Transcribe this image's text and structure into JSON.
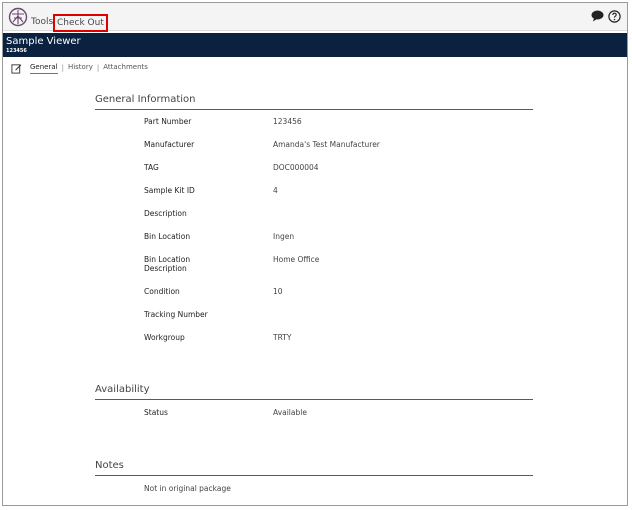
{
  "toolbar": {
    "logo_icon": "brand-logo-icon",
    "tools_label": "Tools",
    "checkout_label": "Check Out",
    "highlight_color": "#e00000",
    "chat_icon": "chat-icon",
    "help_icon": "help-icon"
  },
  "header": {
    "title": "Sample Viewer",
    "subtitle": "123456",
    "background_color": "#0a2240"
  },
  "tabs": [
    {
      "label": "General",
      "active": true
    },
    {
      "label": "History",
      "active": false
    },
    {
      "label": "Attachments",
      "active": false
    }
  ],
  "tab_separator": "|",
  "general": {
    "title": "General Information",
    "fields": [
      {
        "label": "Part Number",
        "value": "123456"
      },
      {
        "label": "Manufacturer",
        "value": "Amanda's Test Manufacturer"
      },
      {
        "label": "TAG",
        "value": "DOC000004"
      },
      {
        "label": "Sample Kit ID",
        "value": "4"
      },
      {
        "label": "Description",
        "value": ""
      },
      {
        "label": "Bin Location",
        "value": "Ingen"
      },
      {
        "label": "Bin Location Description",
        "value": "Home Office"
      },
      {
        "label": "Condition",
        "value": "10"
      },
      {
        "label": "Tracking Number",
        "value": ""
      },
      {
        "label": "Workgroup",
        "value": "TRTY"
      }
    ]
  },
  "availability": {
    "title": "Availability",
    "fields": [
      {
        "label": "Status",
        "value": "Available"
      }
    ]
  },
  "notes": {
    "title": "Notes",
    "text": "Not in original package"
  }
}
